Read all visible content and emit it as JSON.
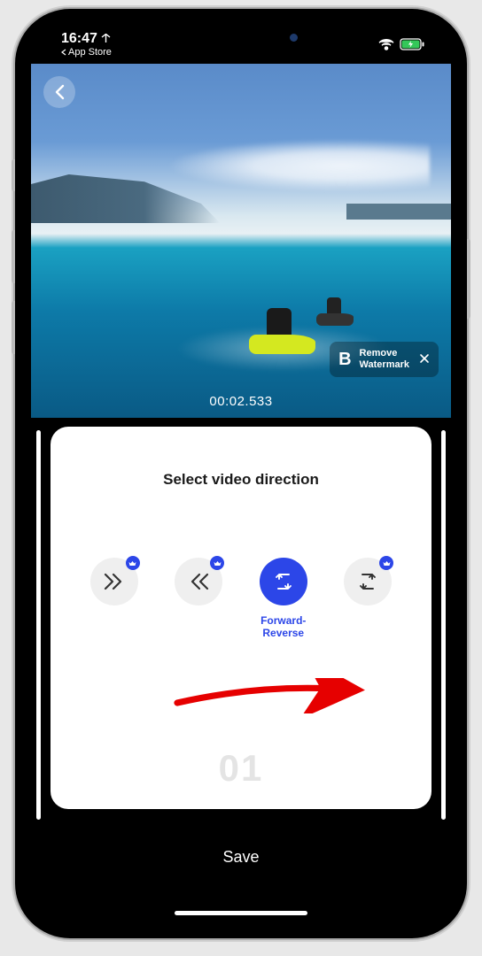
{
  "status": {
    "time": "16:47",
    "back_app": "App Store"
  },
  "video": {
    "timestamp": "00:02.533",
    "watermark": {
      "brand": "B",
      "line1": "Remove",
      "line2": "Watermark"
    }
  },
  "panel": {
    "title": "Select video direction",
    "options": {
      "forward": "",
      "reverse": "",
      "forward_reverse": "Forward-Reverse",
      "reverse_forward": ""
    },
    "page_number": "01"
  },
  "footer": {
    "save": "Save"
  }
}
